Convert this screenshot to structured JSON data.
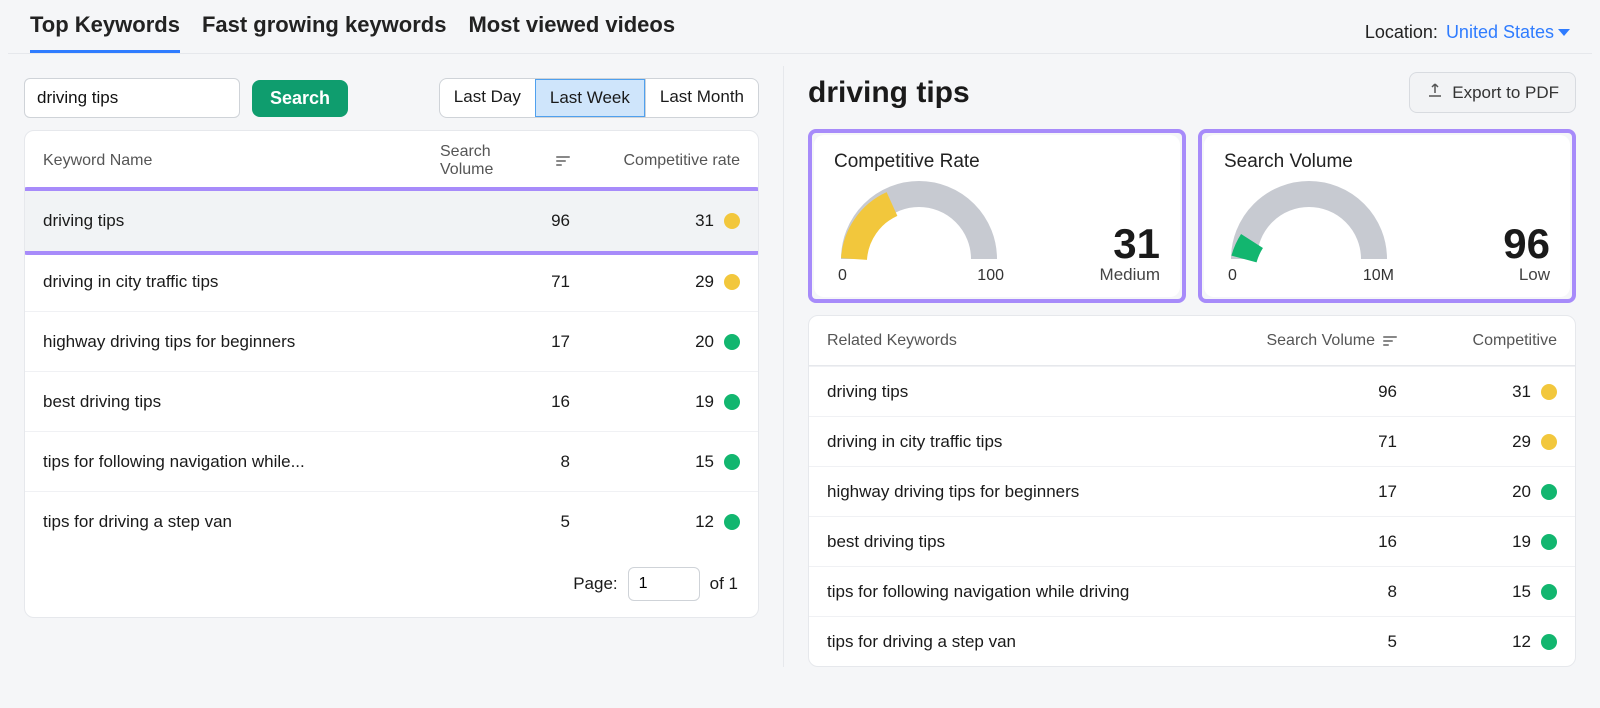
{
  "tabs": {
    "t0": "Top Keywords",
    "t1": "Fast growing keywords",
    "t2": "Most viewed videos"
  },
  "location": {
    "label": "Location:",
    "value": "United States"
  },
  "search": {
    "value": "driving tips",
    "button": "Search",
    "seg0": "Last Day",
    "seg1": "Last Week",
    "seg2": "Last Month"
  },
  "table_left": {
    "h0": "Keyword Name",
    "h1": "Search Volume",
    "h2": "Competitive rate",
    "rows": [
      {
        "kw": "driving tips",
        "sv": "96",
        "cr": "31",
        "dot": "yellow"
      },
      {
        "kw": "driving in city traffic tips",
        "sv": "71",
        "cr": "29",
        "dot": "yellow"
      },
      {
        "kw": "highway driving tips for beginners",
        "sv": "17",
        "cr": "20",
        "dot": "green"
      },
      {
        "kw": "best driving tips",
        "sv": "16",
        "cr": "19",
        "dot": "green"
      },
      {
        "kw": "tips for following navigation while...",
        "sv": "8",
        "cr": "15",
        "dot": "green"
      },
      {
        "kw": "tips for driving a step van",
        "sv": "5",
        "cr": "12",
        "dot": "green"
      }
    ],
    "pager_label": "Page:",
    "pager_page": "1",
    "pager_total": "of 1"
  },
  "detail": {
    "title": "driving tips",
    "export": "Export to PDF",
    "g1_title": "Competitive Rate",
    "g1_value": "31",
    "g1_label": "Medium",
    "g1_min": "0",
    "g1_max": "100",
    "g2_title": "Search Volume",
    "g2_value": "96",
    "g2_label": "Low",
    "g2_min": "0",
    "g2_max": "10M"
  },
  "table_right": {
    "h0": "Related Keywords",
    "h1": "Search Volume",
    "h2": "Competitive",
    "rows": [
      {
        "kw": "driving tips",
        "sv": "96",
        "cr": "31",
        "dot": "yellow"
      },
      {
        "kw": "driving in city traffic tips",
        "sv": "71",
        "cr": "29",
        "dot": "yellow"
      },
      {
        "kw": "highway driving tips for beginners",
        "sv": "17",
        "cr": "20",
        "dot": "green"
      },
      {
        "kw": "best driving tips",
        "sv": "16",
        "cr": "19",
        "dot": "green"
      },
      {
        "kw": "tips for following navigation while driving",
        "sv": "8",
        "cr": "15",
        "dot": "green"
      },
      {
        "kw": "tips for driving a step van",
        "sv": "5",
        "cr": "12",
        "dot": "green"
      }
    ]
  },
  "chart_data": [
    {
      "type": "gauge",
      "title": "Competitive Rate",
      "value": 31,
      "min": 0,
      "max": 100,
      "label": "Medium",
      "fill_color": "#f2c73c"
    },
    {
      "type": "gauge",
      "title": "Search Volume",
      "value": 96,
      "min": 0,
      "max": 10000000,
      "max_label": "10M",
      "label": "Low",
      "fill_fraction_approx": 0.08,
      "fill_color": "#12b66f"
    }
  ]
}
